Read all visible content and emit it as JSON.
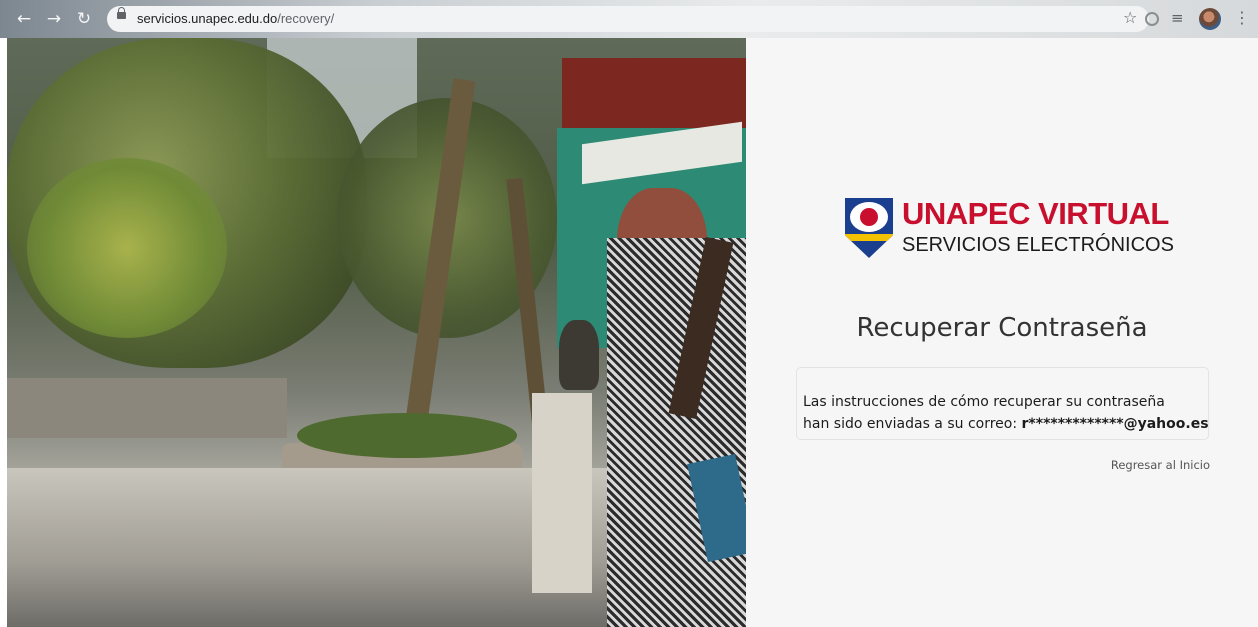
{
  "browser": {
    "url_host": "servicios.unapec.edu.do",
    "url_path": "/recovery/"
  },
  "brand": {
    "name": "UNAPEC VIRTUAL",
    "subtitle": "SERVICIOS ELECTRÓNICOS",
    "shield_text": "UNAPEC"
  },
  "page": {
    "title": "Recuperar Contraseña",
    "message_line1": "Las instrucciones de cómo recuperar su contraseña",
    "message_line2_prefix": "han sido enviadas a su correo: ",
    "message_email": "r*************@yahoo.es",
    "back_link": "Regresar al Inicio"
  },
  "colors": {
    "brand_red": "#c8102e",
    "brand_blue": "#1b3f8f",
    "panel_bg": "#f6f6f6"
  }
}
